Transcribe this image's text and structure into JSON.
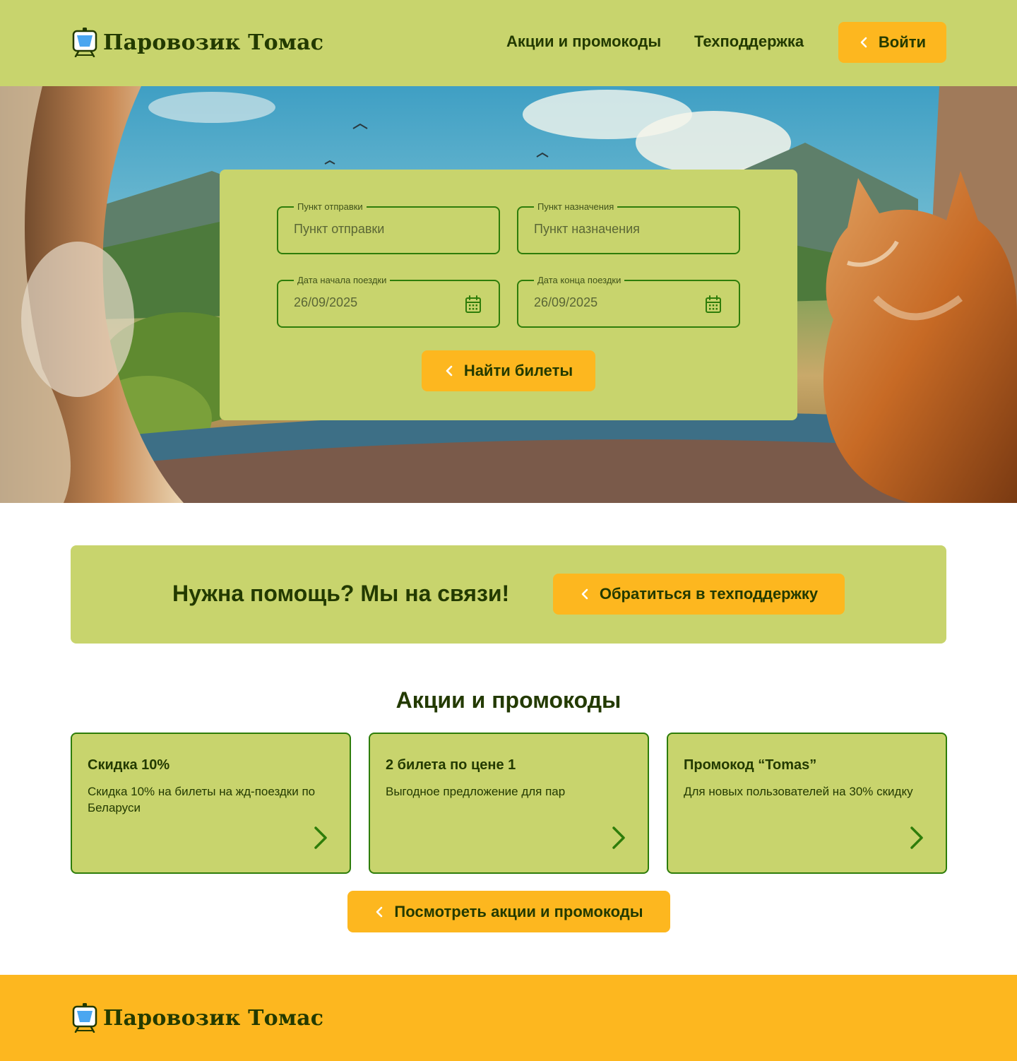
{
  "brand": {
    "name": "Паровозик Томас"
  },
  "nav": {
    "promo": "Акции и промокоды",
    "support": "Техподдержка",
    "login": "Войти"
  },
  "search": {
    "from_label": "Пункт отправки",
    "from_placeholder": "Пункт отправки",
    "to_label": "Пункт назначения",
    "to_placeholder": "Пункт назначения",
    "start_label": "Дата начала поездки",
    "start_value": "26/09/2025",
    "end_label": "Дата конца поездки",
    "end_value": "26/09/2025",
    "submit": "Найти билеты"
  },
  "help": {
    "title": "Нужна помощь? Мы на связи!",
    "button": "Обратиться в техподдержку"
  },
  "promos": {
    "heading": "Акции и промокоды",
    "cards": [
      {
        "title": "Скидка 10%",
        "desc": "Скидка 10% на билеты на жд-поездки по Беларуси"
      },
      {
        "title": "2 билета по цене 1",
        "desc": "Выгодное предложение для пар"
      },
      {
        "title": "Промокод “Tomas”",
        "desc": "Для новых пользователей на 30% скидку"
      }
    ],
    "button": "Посмотреть акции и промокоды"
  },
  "colors": {
    "header_bg": "#c8d46d",
    "accent": "#fdb71f",
    "border_green": "#2e7d0a",
    "text_dark": "#233a00"
  },
  "hero": {
    "image": "cat looking out of train window at mountain landscape"
  }
}
